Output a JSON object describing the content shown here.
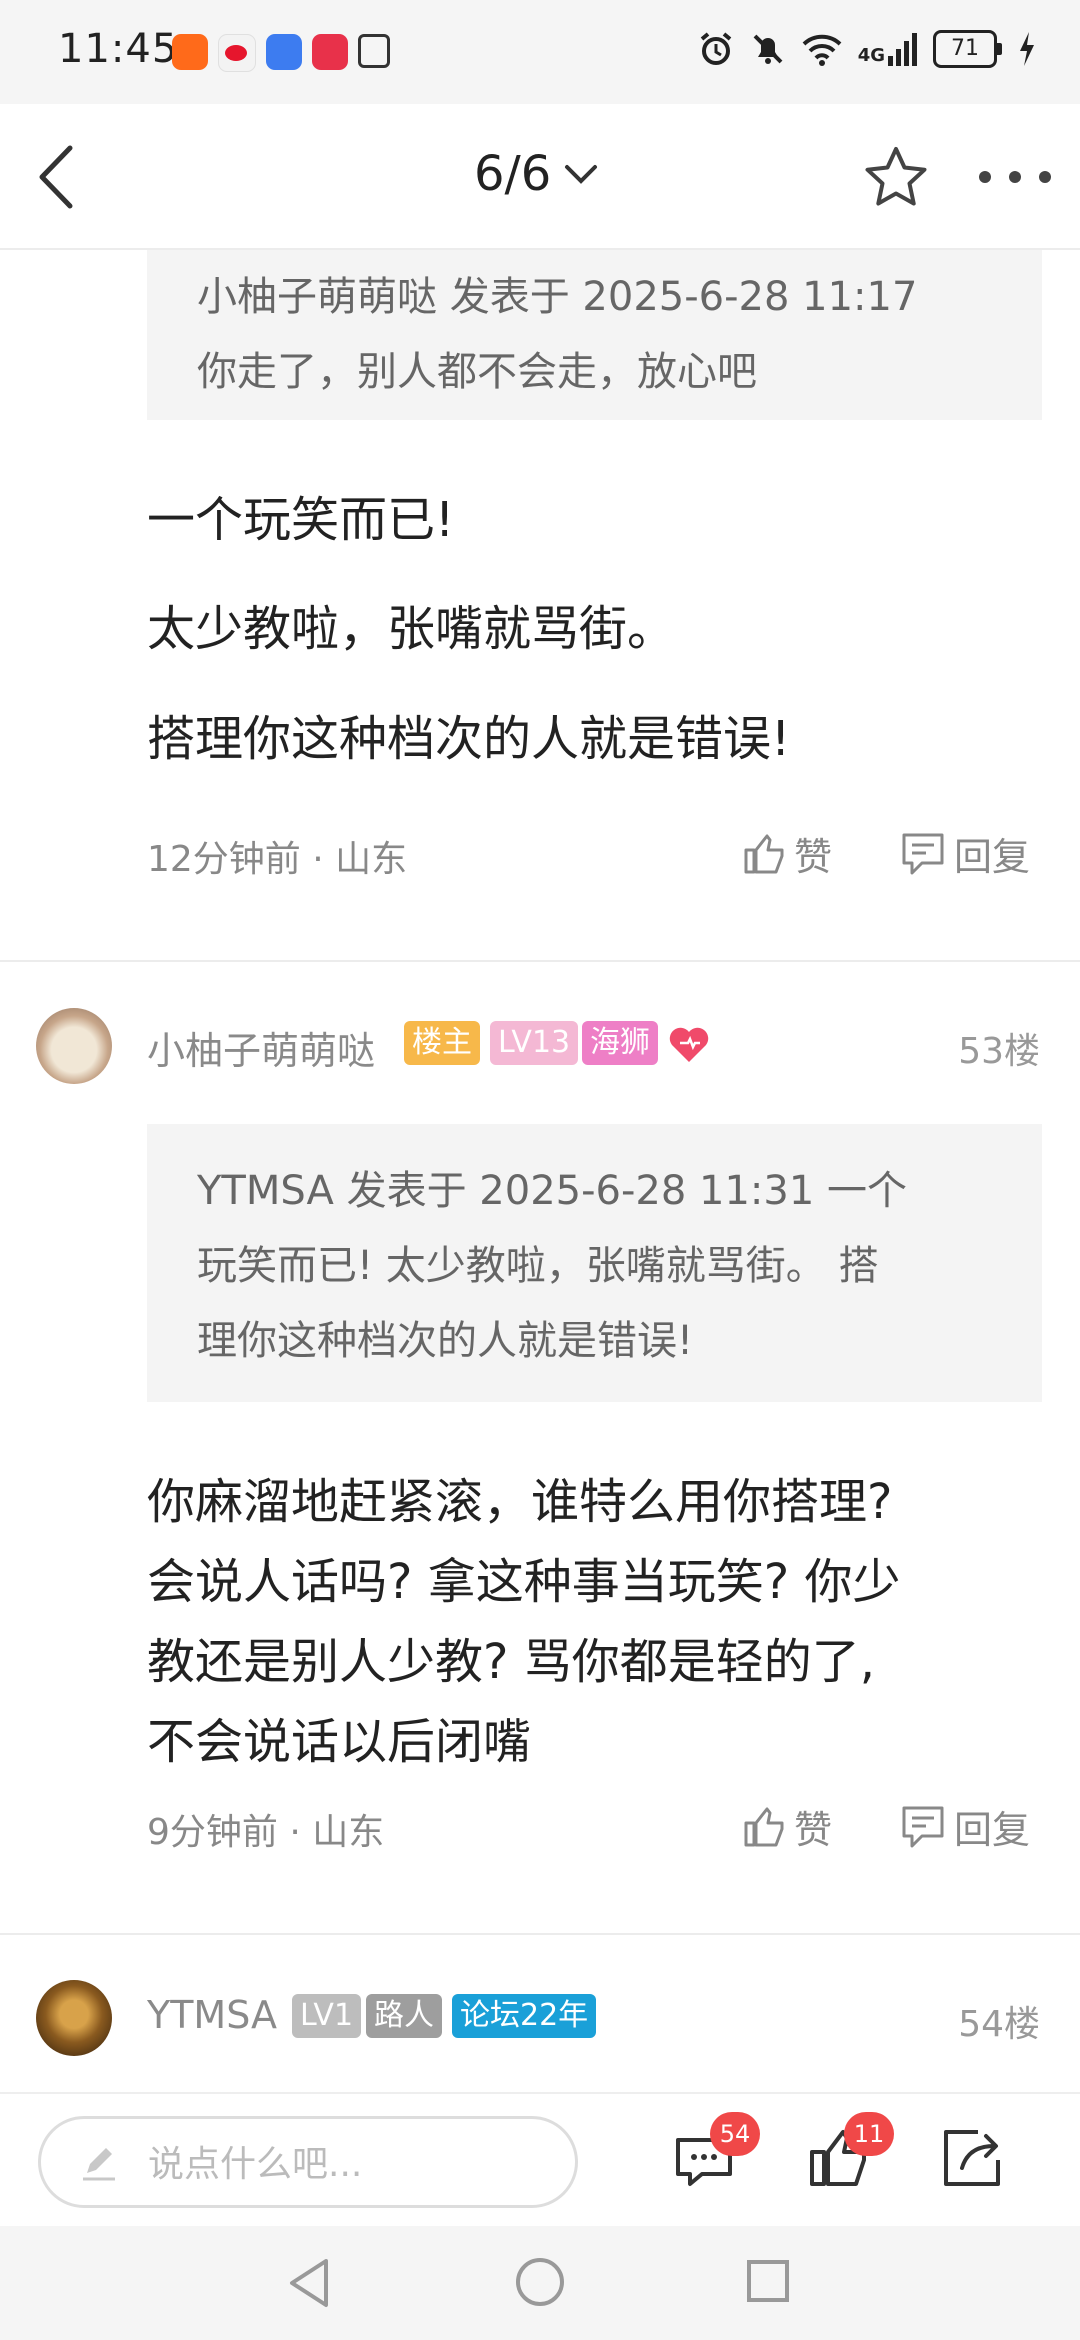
{
  "status_bar": {
    "time": "11:45",
    "battery": "71",
    "network": "4G",
    "icons": [
      "taobao-icon",
      "weibo-icon",
      "app-icon",
      "app-icon",
      "nfc-icon",
      "alarm-icon",
      "mute-icon",
      "wifi-icon",
      "signal-icon",
      "charging-icon"
    ]
  },
  "nav": {
    "page_indicator": "6/6"
  },
  "posts": [
    {
      "quote": [
        "小柚子萌萌哒 发表于 2025-6-28 11:17",
        "你走了，别人都不会走，放心吧"
      ],
      "paragraphs": [
        "一个玩笑而已!",
        "太少教啦，张嘴就骂街。",
        "搭理你这种档次的人就是错误!"
      ],
      "time": "12分钟前",
      "location": "山东",
      "like_label": "赞",
      "reply_label": "回复"
    },
    {
      "username": "小柚子萌萌哒",
      "badges": [
        "楼主",
        "LV13",
        "海狮"
      ],
      "floor": "53楼",
      "quote": [
        "YTMSA 发表于 2025-6-28 11:31 一个",
        "玩笑而已!  太少教啦，张嘴就骂街。 搭",
        "理你这种档次的人就是错误!"
      ],
      "paragraphs": [
        "你麻溜地赶紧滚，谁特么用你搭理?",
        "会说人话吗? 拿这种事当玩笑? 你少",
        "教还是别人少教? 骂你都是轻的了,",
        "不会说话以后闭嘴"
      ],
      "time": "9分钟前",
      "location": "山东",
      "like_label": "赞",
      "reply_label": "回复"
    },
    {
      "username": "YTMSA",
      "badges": [
        "LV1",
        "路人",
        "论坛22年"
      ],
      "floor": "54楼"
    }
  ],
  "bottom_bar": {
    "placeholder": "说点什么吧...",
    "comment_count": "54",
    "like_count": "11"
  },
  "colors": {
    "badge_owner": "#f7b84a",
    "badge_level": "#f4b8d4",
    "badge_title": "#ee7fc6",
    "badge_gray": "#bdbdbd",
    "badge_dark_gray": "#9e9e9e",
    "badge_blue": "#1aa0d8",
    "count_badge": "#f04848"
  }
}
